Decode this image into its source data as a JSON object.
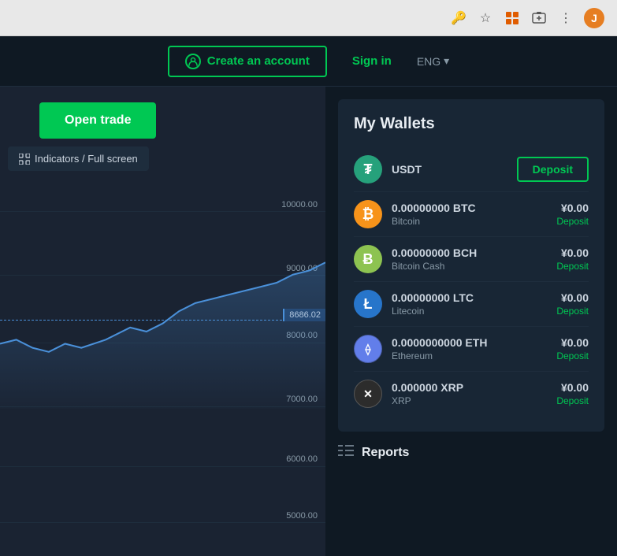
{
  "browser": {
    "icons": [
      {
        "name": "key-icon",
        "glyph": "🔑"
      },
      {
        "name": "star-icon",
        "glyph": "☆"
      },
      {
        "name": "extension-icon",
        "glyph": "🟧"
      },
      {
        "name": "screenshot-icon",
        "glyph": "🖼"
      },
      {
        "name": "avatar-initial",
        "glyph": "J"
      }
    ]
  },
  "header": {
    "create_account_label": "Create an account",
    "sign_in_label": "Sign in",
    "lang_label": "ENG"
  },
  "chart": {
    "open_trade_label": "Open trade",
    "indicators_label": "Indicators / Full screen",
    "prices": [
      {
        "label": "10000.00",
        "pct": 10
      },
      {
        "label": "9000.00",
        "pct": 30
      },
      {
        "label": "8000.00",
        "pct": 50
      },
      {
        "label": "7000.00",
        "pct": 65
      },
      {
        "label": "6000.00",
        "pct": 80
      },
      {
        "label": "5000.00",
        "pct": 92
      }
    ],
    "current_price": "8686.02"
  },
  "wallets": {
    "title": "My Wallets",
    "items": [
      {
        "coin": "usdt",
        "symbol": "₮",
        "amount": "USDT",
        "name": "",
        "value": "",
        "show_deposit_btn": true,
        "deposit_label": "Deposit"
      },
      {
        "coin": "btc",
        "symbol": "₿",
        "amount": "0.00000000 BTC",
        "name": "Bitcoin",
        "value": "¥0.00",
        "deposit_text": "Deposit",
        "show_deposit_btn": false
      },
      {
        "coin": "bch",
        "symbol": "Ƀ",
        "amount": "0.00000000 BCH",
        "name": "Bitcoin Cash",
        "value": "¥0.00",
        "deposit_text": "Deposit",
        "show_deposit_btn": false
      },
      {
        "coin": "ltc",
        "symbol": "Ł",
        "amount": "0.00000000 LTC",
        "name": "Litecoin",
        "value": "¥0.00",
        "deposit_text": "Deposit",
        "show_deposit_btn": false
      },
      {
        "coin": "eth",
        "symbol": "⟠",
        "amount": "0.0000000000 ETH",
        "name": "Ethereum",
        "value": "¥0.00",
        "deposit_text": "Deposit",
        "show_deposit_btn": false
      },
      {
        "coin": "xrp",
        "symbol": "✕",
        "amount": "0.000000 XRP",
        "name": "XRP",
        "value": "¥0.00",
        "deposit_text": "Deposit",
        "show_deposit_btn": false
      }
    ]
  },
  "reports": {
    "label": "Reports"
  }
}
